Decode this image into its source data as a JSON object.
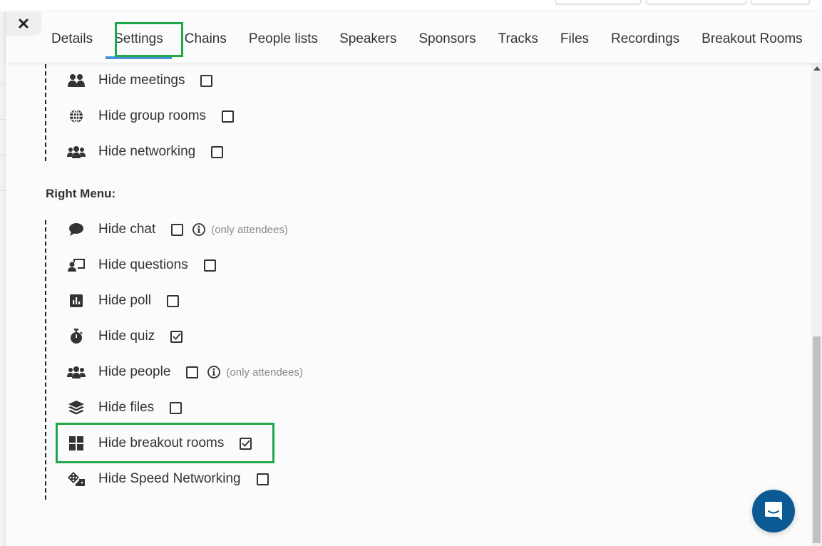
{
  "header": {
    "close_label": "×",
    "tabs": [
      {
        "label": "Details",
        "active": false
      },
      {
        "label": "Settings",
        "active": true
      },
      {
        "label": "Chains",
        "active": false
      },
      {
        "label": "People lists",
        "active": false
      },
      {
        "label": "Speakers",
        "active": false
      },
      {
        "label": "Sponsors",
        "active": false
      },
      {
        "label": "Tracks",
        "active": false
      },
      {
        "label": "Files",
        "active": false
      },
      {
        "label": "Recordings",
        "active": false
      },
      {
        "label": "Breakout Rooms",
        "active": false
      }
    ]
  },
  "left_menu": {
    "items": [
      {
        "label": "Hide meetings",
        "icon": "users-icon",
        "checked": false
      },
      {
        "label": "Hide group rooms",
        "icon": "globe-icon",
        "checked": false
      },
      {
        "label": "Hide networking",
        "icon": "user-group-icon",
        "checked": false
      }
    ]
  },
  "right_menu": {
    "title": "Right Menu:",
    "items": [
      {
        "label": "Hide chat",
        "icon": "comment-icon",
        "checked": false,
        "note": "(only attendees)"
      },
      {
        "label": "Hide questions",
        "icon": "chalkboard-user-icon",
        "checked": false
      },
      {
        "label": "Hide poll",
        "icon": "poll-icon",
        "checked": false
      },
      {
        "label": "Hide quiz",
        "icon": "stopwatch-icon",
        "checked": true
      },
      {
        "label": "Hide people",
        "icon": "user-group-icon",
        "checked": false,
        "note": "(only attendees)"
      },
      {
        "label": "Hide files",
        "icon": "layers-icon",
        "checked": false
      },
      {
        "label": "Hide breakout rooms",
        "icon": "grid-icon",
        "checked": true
      },
      {
        "label": "Hide Speed Networking",
        "icon": "dice-icon",
        "checked": false
      }
    ]
  },
  "colors": {
    "highlight": "#1fa84a",
    "active_tab_underline": "#4a90d9",
    "chat_launcher": "#0b5a94"
  }
}
